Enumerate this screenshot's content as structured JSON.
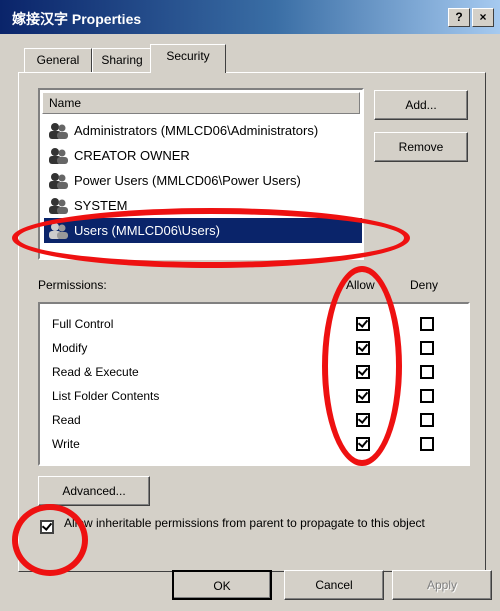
{
  "window": {
    "title": "嫁接汉字 Properties",
    "help_label": "?",
    "close_label": "×"
  },
  "tabs": [
    {
      "label": "General"
    },
    {
      "label": "Sharing"
    },
    {
      "label": "Security",
      "active": true
    }
  ],
  "names": {
    "header": "Name",
    "items": [
      {
        "label": "Administrators (MMLCD06\\Administrators)"
      },
      {
        "label": "CREATOR OWNER"
      },
      {
        "label": "Power Users (MMLCD06\\Power Users)"
      },
      {
        "label": "SYSTEM"
      },
      {
        "label": "Users (MMLCD06\\Users)",
        "selected": true
      }
    ]
  },
  "buttons": {
    "add": "Add...",
    "remove": "Remove",
    "advanced": "Advanced...",
    "ok": "OK",
    "cancel": "Cancel",
    "apply": "Apply"
  },
  "permissions": {
    "label": "Permissions:",
    "allow_header": "Allow",
    "deny_header": "Deny",
    "items": [
      {
        "label": "Full Control",
        "allow": true,
        "deny": false
      },
      {
        "label": "Modify",
        "allow": true,
        "deny": false
      },
      {
        "label": "Read & Execute",
        "allow": true,
        "deny": false
      },
      {
        "label": "List Folder Contents",
        "allow": true,
        "deny": false
      },
      {
        "label": "Read",
        "allow": true,
        "deny": false
      },
      {
        "label": "Write",
        "allow": true,
        "deny": false
      }
    ]
  },
  "inherit": {
    "label": "Allow inheritable permissions from parent to propagate to this object",
    "checked": true
  },
  "colors": {
    "annotation": "#ee1111",
    "selection": "#0a246a"
  }
}
